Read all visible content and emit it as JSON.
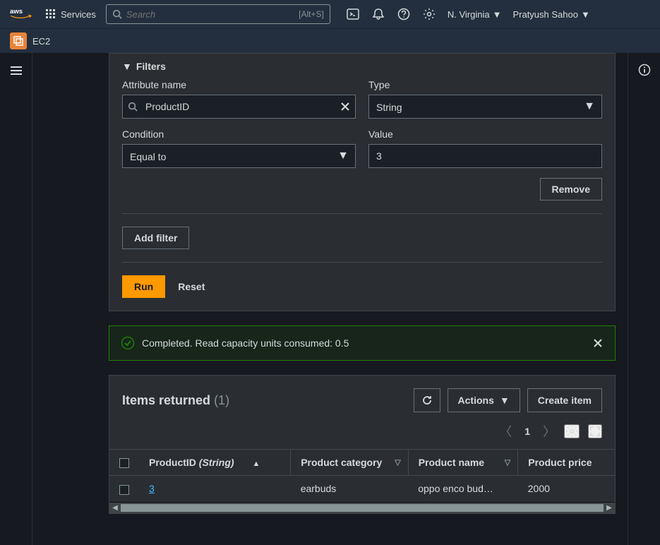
{
  "header": {
    "services_label": "Services",
    "search_placeholder": "Search",
    "search_shortcut": "[Alt+S]",
    "region": "N. Virginia",
    "user": "Pratyush Sahoo"
  },
  "subheader": {
    "service": "EC2"
  },
  "filters": {
    "title": "Filters",
    "attribute_name_label": "Attribute name",
    "attribute_name_value": "ProductID",
    "type_label": "Type",
    "type_value": "String",
    "condition_label": "Condition",
    "condition_value": "Equal to",
    "value_label": "Value",
    "value_value": "3",
    "remove_btn": "Remove",
    "add_filter_btn": "Add filter",
    "run_btn": "Run",
    "reset_btn": "Reset"
  },
  "banner": {
    "message": "Completed. Read capacity units consumed: 0.5"
  },
  "items": {
    "title": "Items returned",
    "count": "(1)",
    "actions_btn": "Actions",
    "create_btn": "Create item",
    "page": "1",
    "columns": {
      "pk_name": "ProductID",
      "pk_type": "(String)",
      "cat": "Product category",
      "name": "Product name",
      "price": "Product price"
    },
    "rows": [
      {
        "id": "3",
        "category": "earbuds",
        "name": "oppo enco bud…",
        "price": "2000"
      }
    ]
  }
}
